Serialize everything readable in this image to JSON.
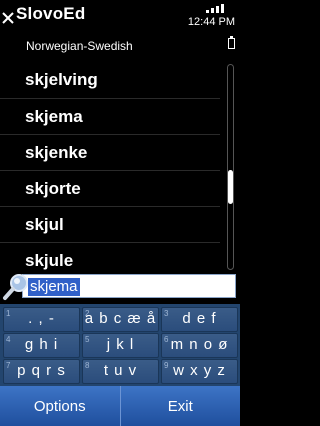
{
  "status": {
    "app_title": "SlovoEd",
    "clock": "12:44 PM",
    "dictionary": "Norwegian-Swedish"
  },
  "words": [
    "skjelving",
    "skjema",
    "skjenke",
    "skjorte",
    "skjul",
    "skjule"
  ],
  "scroll_fraction": 0.62,
  "search": {
    "value": "skjema"
  },
  "keypad": {
    "keys": [
      {
        "num": "1",
        "chars": ". , -"
      },
      {
        "num": "2",
        "chars": "a b c æ å"
      },
      {
        "num": "3",
        "chars": "d e f"
      },
      {
        "num": "4",
        "chars": "g h i"
      },
      {
        "num": "5",
        "chars": "j k l"
      },
      {
        "num": "6",
        "chars": "m n o ø"
      },
      {
        "num": "7",
        "chars": "p q r s"
      },
      {
        "num": "8",
        "chars": "t u v"
      },
      {
        "num": "9",
        "chars": "w x y z"
      }
    ]
  },
  "softkeys": {
    "left": "Options",
    "right": "Exit"
  },
  "icons": [
    "close-icon",
    "signal-icon",
    "battery-icon",
    "search-icon"
  ],
  "colors": {
    "accent": "#3d74c6",
    "keypad": "#23456e",
    "selection": "#3060c8"
  }
}
